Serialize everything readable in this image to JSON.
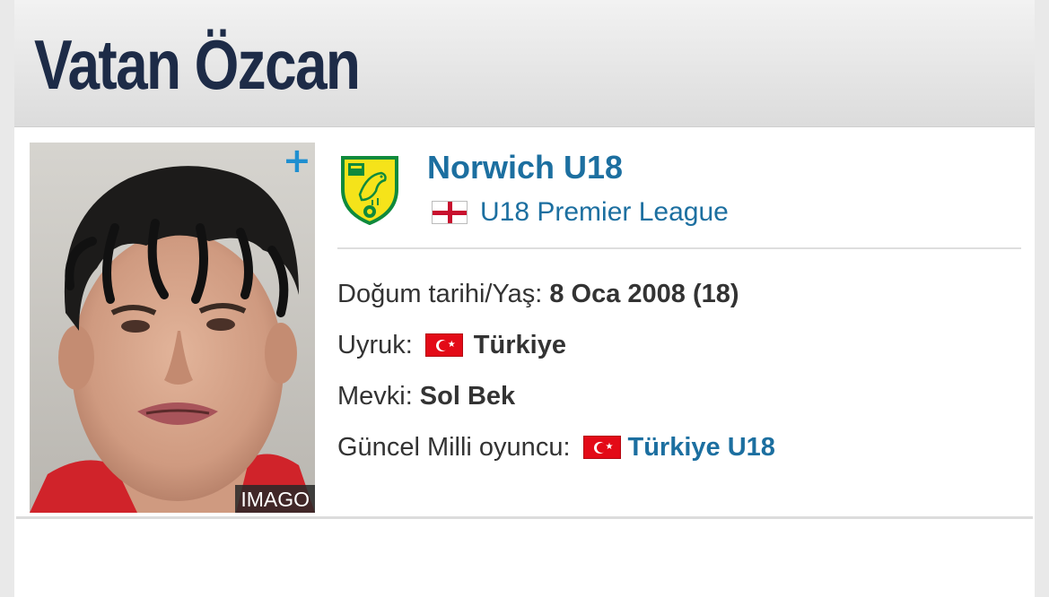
{
  "player": {
    "name": "Vatan Özcan",
    "photo_credit": "IMAGO",
    "photo_action_icon": "plus-icon"
  },
  "club": {
    "name": "Norwich U18",
    "crest_icon": "norwich-city-crest",
    "league": {
      "name": "U18 Premier League",
      "flag_icon": "england-flag-icon"
    }
  },
  "details": {
    "birth": {
      "label": "Doğum tarihi/Yaş:",
      "value": "8 Oca 2008 (18)"
    },
    "nationality": {
      "label": "Uyruk:",
      "value": "Türkiye",
      "flag_icon": "turkey-flag-icon"
    },
    "position": {
      "label": "Mevki:",
      "value": "Sol Bek"
    },
    "national_team": {
      "label": "Güncel Milli oyuncu:",
      "value": "Türkiye U18",
      "flag_icon": "turkey-flag-icon"
    }
  },
  "colors": {
    "link": "#1c6fa0",
    "title": "#1d2b47",
    "crest_yellow": "#f5e31a",
    "crest_green": "#0f8a3c",
    "turkey_red": "#e30a17"
  }
}
